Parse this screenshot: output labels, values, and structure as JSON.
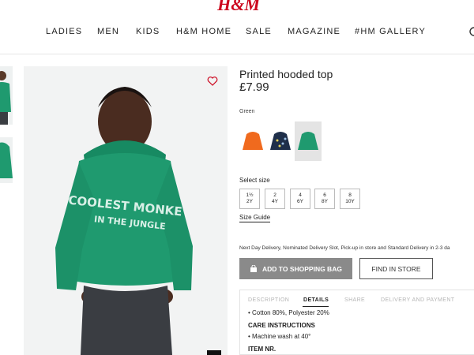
{
  "header": {
    "logo": "H&M",
    "nav": [
      "LADIES",
      "MEN",
      "KIDS",
      "H&M HOME",
      "SALE",
      "MAGAZINE",
      "#HM GALLERY"
    ]
  },
  "product": {
    "name": "Printed hooded top",
    "price": "£7.99",
    "color_label": "Green",
    "image_print": [
      "COOLEST MONKE",
      "IN THE JUNGLE"
    ],
    "swatches": [
      {
        "name": "orange hooded top",
        "color": "#f06a1e"
      },
      {
        "name": "dark printed hooded top",
        "color": "#1f2f4a"
      },
      {
        "name": "green hooded top",
        "color": "#1f9a6f"
      }
    ],
    "size_label": "Select size",
    "sizes": [
      {
        "l1": "1½",
        "l2": "2Y"
      },
      {
        "l1": "2",
        "l2": "4Y"
      },
      {
        "l1": "4",
        "l2": "6Y"
      },
      {
        "l1": "6",
        "l2": "8Y"
      },
      {
        "l1": "8",
        "l2": "10Y"
      }
    ],
    "size_guide": "Size Guide",
    "delivery": "Next Day Delivery, Nominated Delivery Slot, Pick-up in store and Standard Delivery in 2-3 da",
    "add_to_bag": "ADD TO SHOPPING BAG",
    "find_in_store": "FIND IN STORE",
    "tabs": [
      "DESCRIPTION",
      "DETAILS",
      "SHARE",
      "DELIVERY AND PAYMENT"
    ],
    "active_tab": "DETAILS",
    "details": {
      "material": "Cotton 80%, Polyester 20%",
      "care_heading": "CARE INSTRUCTIONS",
      "care_item": "Machine wash at 40°",
      "item_heading": "ITEM NR."
    }
  },
  "colors": {
    "brand": "#cc071e",
    "hoodie": "#1f9a6f",
    "button": "#8a8a8a"
  }
}
